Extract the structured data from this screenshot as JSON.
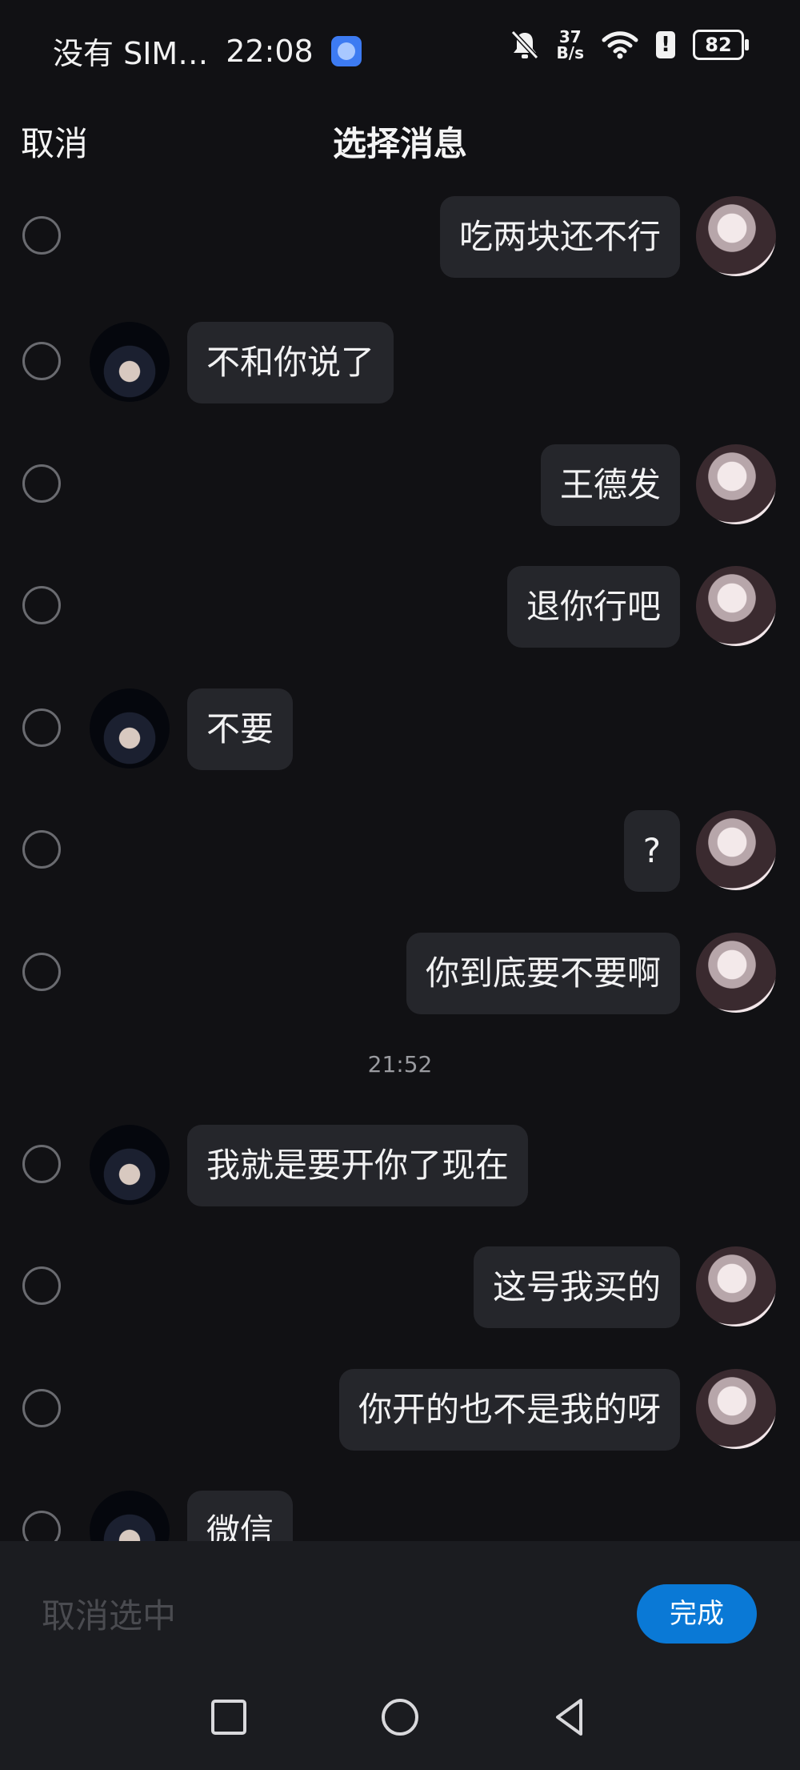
{
  "status_bar": {
    "carrier": "没有 SIM…",
    "time": "22:08",
    "speed_top": "37",
    "speed_unit": "B/s",
    "battery": "82"
  },
  "header": {
    "cancel": "取消",
    "title": "选择消息"
  },
  "messages": [
    {
      "side": "right",
      "text": "吃两块还不行"
    },
    {
      "side": "left",
      "text": "不和你说了"
    },
    {
      "side": "right",
      "text": "王德发"
    },
    {
      "side": "right",
      "text": "退你行吧"
    },
    {
      "side": "left",
      "text": "不要"
    },
    {
      "side": "right",
      "text": "?"
    },
    {
      "side": "right",
      "text": "你到底要不要啊"
    },
    {
      "separator": "21:52"
    },
    {
      "side": "left",
      "text": "我就是要开你了现在"
    },
    {
      "side": "right",
      "text": "这号我买的"
    },
    {
      "side": "right",
      "text": "你开的也不是我的呀"
    },
    {
      "side": "left",
      "text": "微信"
    }
  ],
  "bottom": {
    "deselect": "取消选中",
    "done": "完成"
  }
}
